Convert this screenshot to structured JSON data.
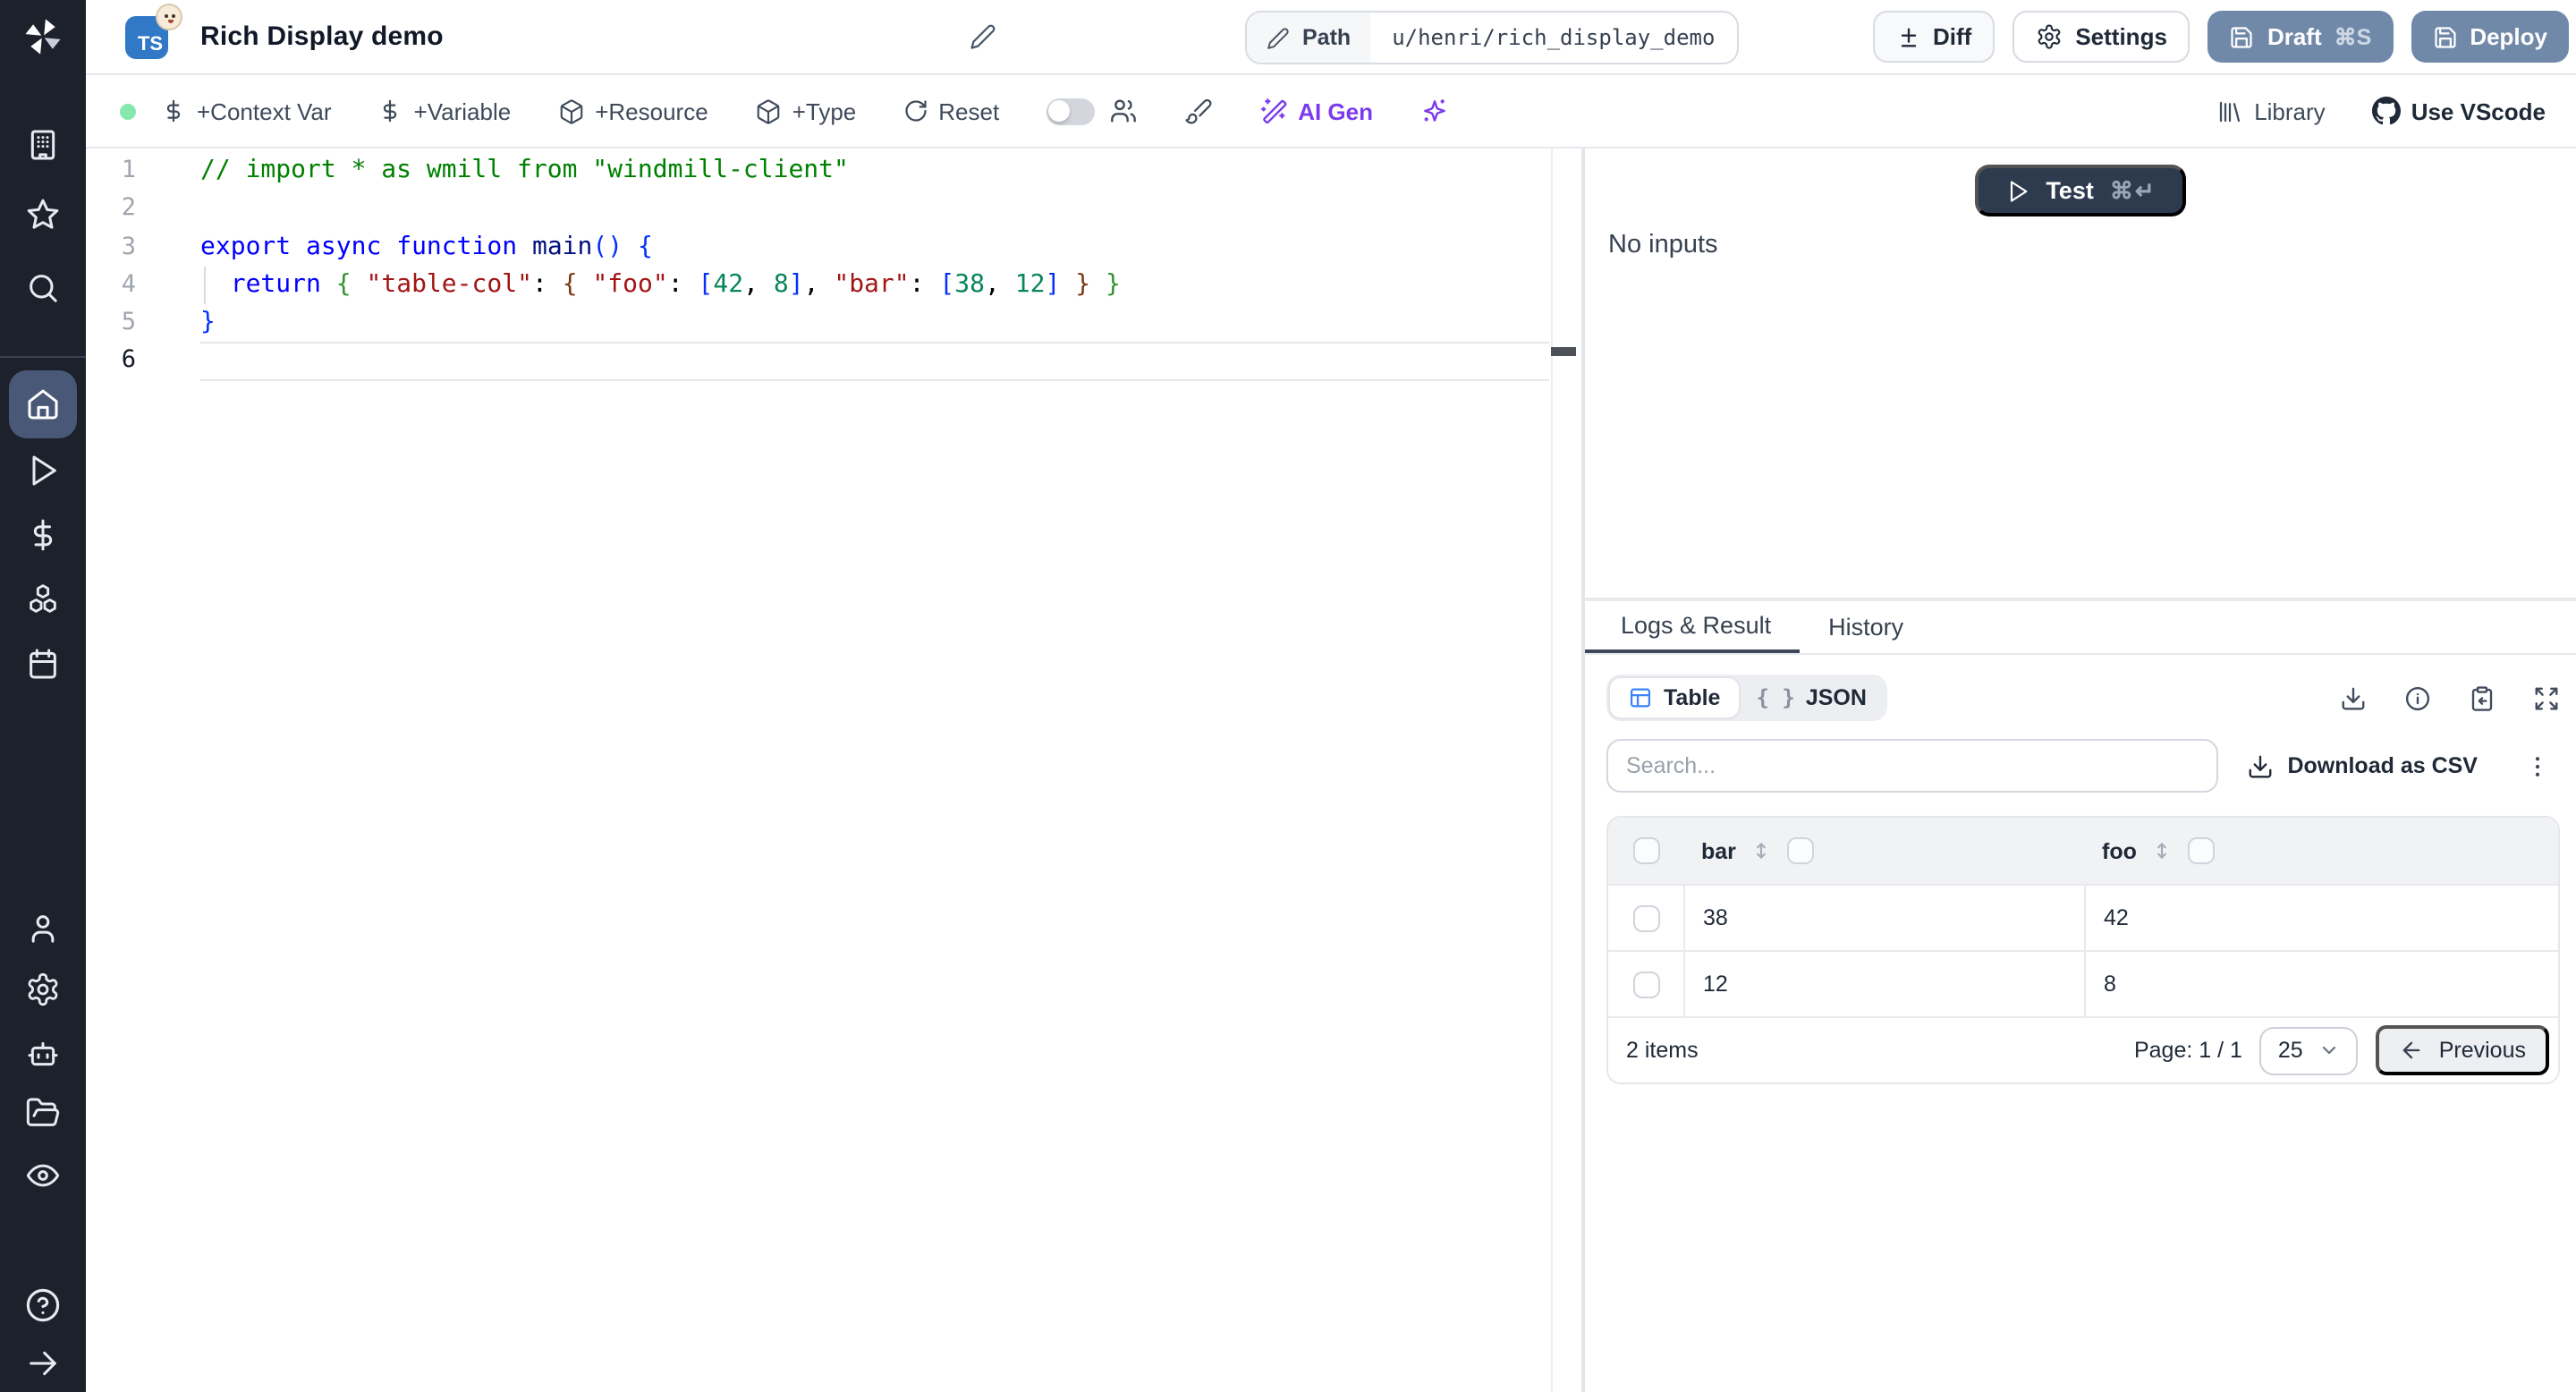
{
  "topbar": {
    "script_language": "TS",
    "title": "Rich Display demo",
    "path_label": "Path",
    "path_value": "u/henri/rich_display_demo",
    "diff_label": "Diff",
    "settings_label": "Settings",
    "draft_label": "Draft",
    "draft_shortcut": "⌘S",
    "deploy_label": "Deploy"
  },
  "toolbar": {
    "context_var_label": "+Context Var",
    "variable_label": "+Variable",
    "resource_label": "+Resource",
    "type_label": "+Type",
    "reset_label": "Reset",
    "ai_gen_label": "AI Gen",
    "library_label": "Library",
    "vscode_label": "Use VScode"
  },
  "editor": {
    "line_numbers": [
      "1",
      "2",
      "3",
      "4",
      "5",
      "6"
    ],
    "active_line": 6,
    "token_colors": {
      "comment": "#008000",
      "kw": "#0000ff",
      "fn": "#001080",
      "str": "#a31515",
      "num": "#098658",
      "pun": "#000000",
      "b1": "#0431fa",
      "b2": "#319331",
      "b3": "#7b3814"
    },
    "lines": [
      [
        {
          "t": "// import * as wmill from \"windmill-client\"",
          "c": "comment"
        }
      ],
      [],
      [
        {
          "t": "export",
          "c": "kw"
        },
        {
          "t": " ",
          "c": ""
        },
        {
          "t": "async",
          "c": "kw"
        },
        {
          "t": " ",
          "c": ""
        },
        {
          "t": "function",
          "c": "kw"
        },
        {
          "t": " ",
          "c": ""
        },
        {
          "t": "main",
          "c": "fn"
        },
        {
          "t": "(",
          "c": "b1"
        },
        {
          "t": ")",
          "c": "b1"
        },
        {
          "t": " ",
          "c": ""
        },
        {
          "t": "{",
          "c": "b1"
        }
      ],
      [
        {
          "t": "  ",
          "c": ""
        },
        {
          "t": "return",
          "c": "kw"
        },
        {
          "t": " ",
          "c": ""
        },
        {
          "t": "{",
          "c": "b2"
        },
        {
          "t": " ",
          "c": ""
        },
        {
          "t": "\"table-col\"",
          "c": "str"
        },
        {
          "t": ":",
          "c": "pun"
        },
        {
          "t": " ",
          "c": ""
        },
        {
          "t": "{",
          "c": "b3"
        },
        {
          "t": " ",
          "c": ""
        },
        {
          "t": "\"foo\"",
          "c": "str"
        },
        {
          "t": ":",
          "c": "pun"
        },
        {
          "t": " ",
          "c": ""
        },
        {
          "t": "[",
          "c": "b1"
        },
        {
          "t": "42",
          "c": "num"
        },
        {
          "t": ",",
          "c": "pun"
        },
        {
          "t": " ",
          "c": ""
        },
        {
          "t": "8",
          "c": "num"
        },
        {
          "t": "]",
          "c": "b1"
        },
        {
          "t": ",",
          "c": "pun"
        },
        {
          "t": " ",
          "c": ""
        },
        {
          "t": "\"bar\"",
          "c": "str"
        },
        {
          "t": ":",
          "c": "pun"
        },
        {
          "t": " ",
          "c": ""
        },
        {
          "t": "[",
          "c": "b1"
        },
        {
          "t": "38",
          "c": "num"
        },
        {
          "t": ",",
          "c": "pun"
        },
        {
          "t": " ",
          "c": ""
        },
        {
          "t": "12",
          "c": "num"
        },
        {
          "t": "]",
          "c": "b1"
        },
        {
          "t": " ",
          "c": ""
        },
        {
          "t": "}",
          "c": "b3"
        },
        {
          "t": " ",
          "c": ""
        },
        {
          "t": "}",
          "c": "b2"
        }
      ],
      [
        {
          "t": "}",
          "c": "b1"
        }
      ],
      []
    ]
  },
  "test_panel": {
    "test_label": "Test",
    "test_shortcut": "⌘↵",
    "no_inputs": "No inputs"
  },
  "tabs": {
    "logs_result": "Logs & Result",
    "history": "History"
  },
  "result_view": {
    "table_label": "Table",
    "json_icon": "{ }",
    "json_label": "JSON",
    "search_placeholder": "Search...",
    "download_csv_label": "Download as CSV"
  },
  "table": {
    "columns": [
      "bar",
      "foo"
    ],
    "rows": [
      {
        "bar": "38",
        "foo": "42"
      },
      {
        "bar": "12",
        "foo": "8"
      }
    ],
    "items_label": "2 items",
    "page_label": "Page: 1 / 1",
    "page_size": "25",
    "previous_label": "Previous"
  },
  "colors": {
    "sidebar_bg": "#1d212b",
    "sidebar_active": "#4a5878",
    "deploy_button": "#7189a9",
    "test_button": "#2e3a4e",
    "ai_purple": "#7c3aed",
    "status_green": "#86e8ac",
    "accent": "#3b82f6"
  }
}
